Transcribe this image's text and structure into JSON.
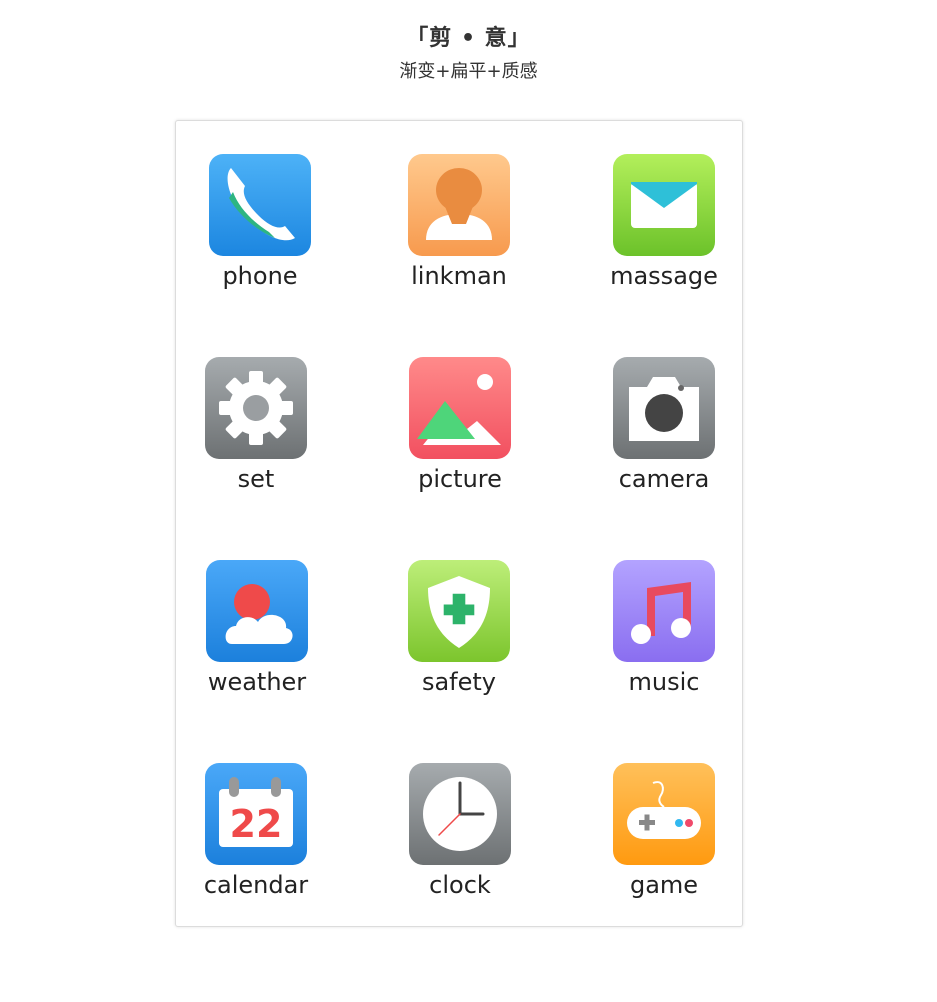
{
  "header": {
    "title": "「剪 • 意」",
    "subtitle": "渐变+扁平+质感"
  },
  "apps": [
    {
      "label": "phone",
      "icon": "phone-icon",
      "gradient": [
        "#4db2f7",
        "#1c86e0"
      ]
    },
    {
      "label": "linkman",
      "icon": "contact-icon",
      "gradient": [
        "#ffc98d",
        "#f79a4e"
      ]
    },
    {
      "label": "massage",
      "icon": "mail-icon",
      "gradient": [
        "#b3ef5b",
        "#6cc22a"
      ]
    },
    {
      "label": "set",
      "icon": "gear-icon",
      "gradient": [
        "#a6abae",
        "#6d7173"
      ]
    },
    {
      "label": "picture",
      "icon": "picture-icon",
      "gradient": [
        "#ff8a8a",
        "#f25060"
      ]
    },
    {
      "label": "camera",
      "icon": "camera-icon",
      "gradient": [
        "#a6abae",
        "#6d7173"
      ]
    },
    {
      "label": "weather",
      "icon": "weather-icon",
      "gradient": [
        "#4aa8f8",
        "#1c80dc"
      ]
    },
    {
      "label": "safety",
      "icon": "shield-icon",
      "gradient": [
        "#bdee79",
        "#7cc52d"
      ]
    },
    {
      "label": "music",
      "icon": "music-icon",
      "gradient": [
        "#b3a3ff",
        "#8a6ef0"
      ]
    },
    {
      "label": "calendar",
      "icon": "calendar-icon",
      "gradient": [
        "#4aa8f8",
        "#1c80dc"
      ]
    },
    {
      "label": "clock",
      "icon": "clock-icon",
      "gradient": [
        "#a6abae",
        "#6d7173"
      ]
    },
    {
      "label": "game",
      "icon": "gamepad-icon",
      "gradient": [
        "#ffc05a",
        "#ff9a10"
      ]
    }
  ],
  "calendar_day": "22"
}
